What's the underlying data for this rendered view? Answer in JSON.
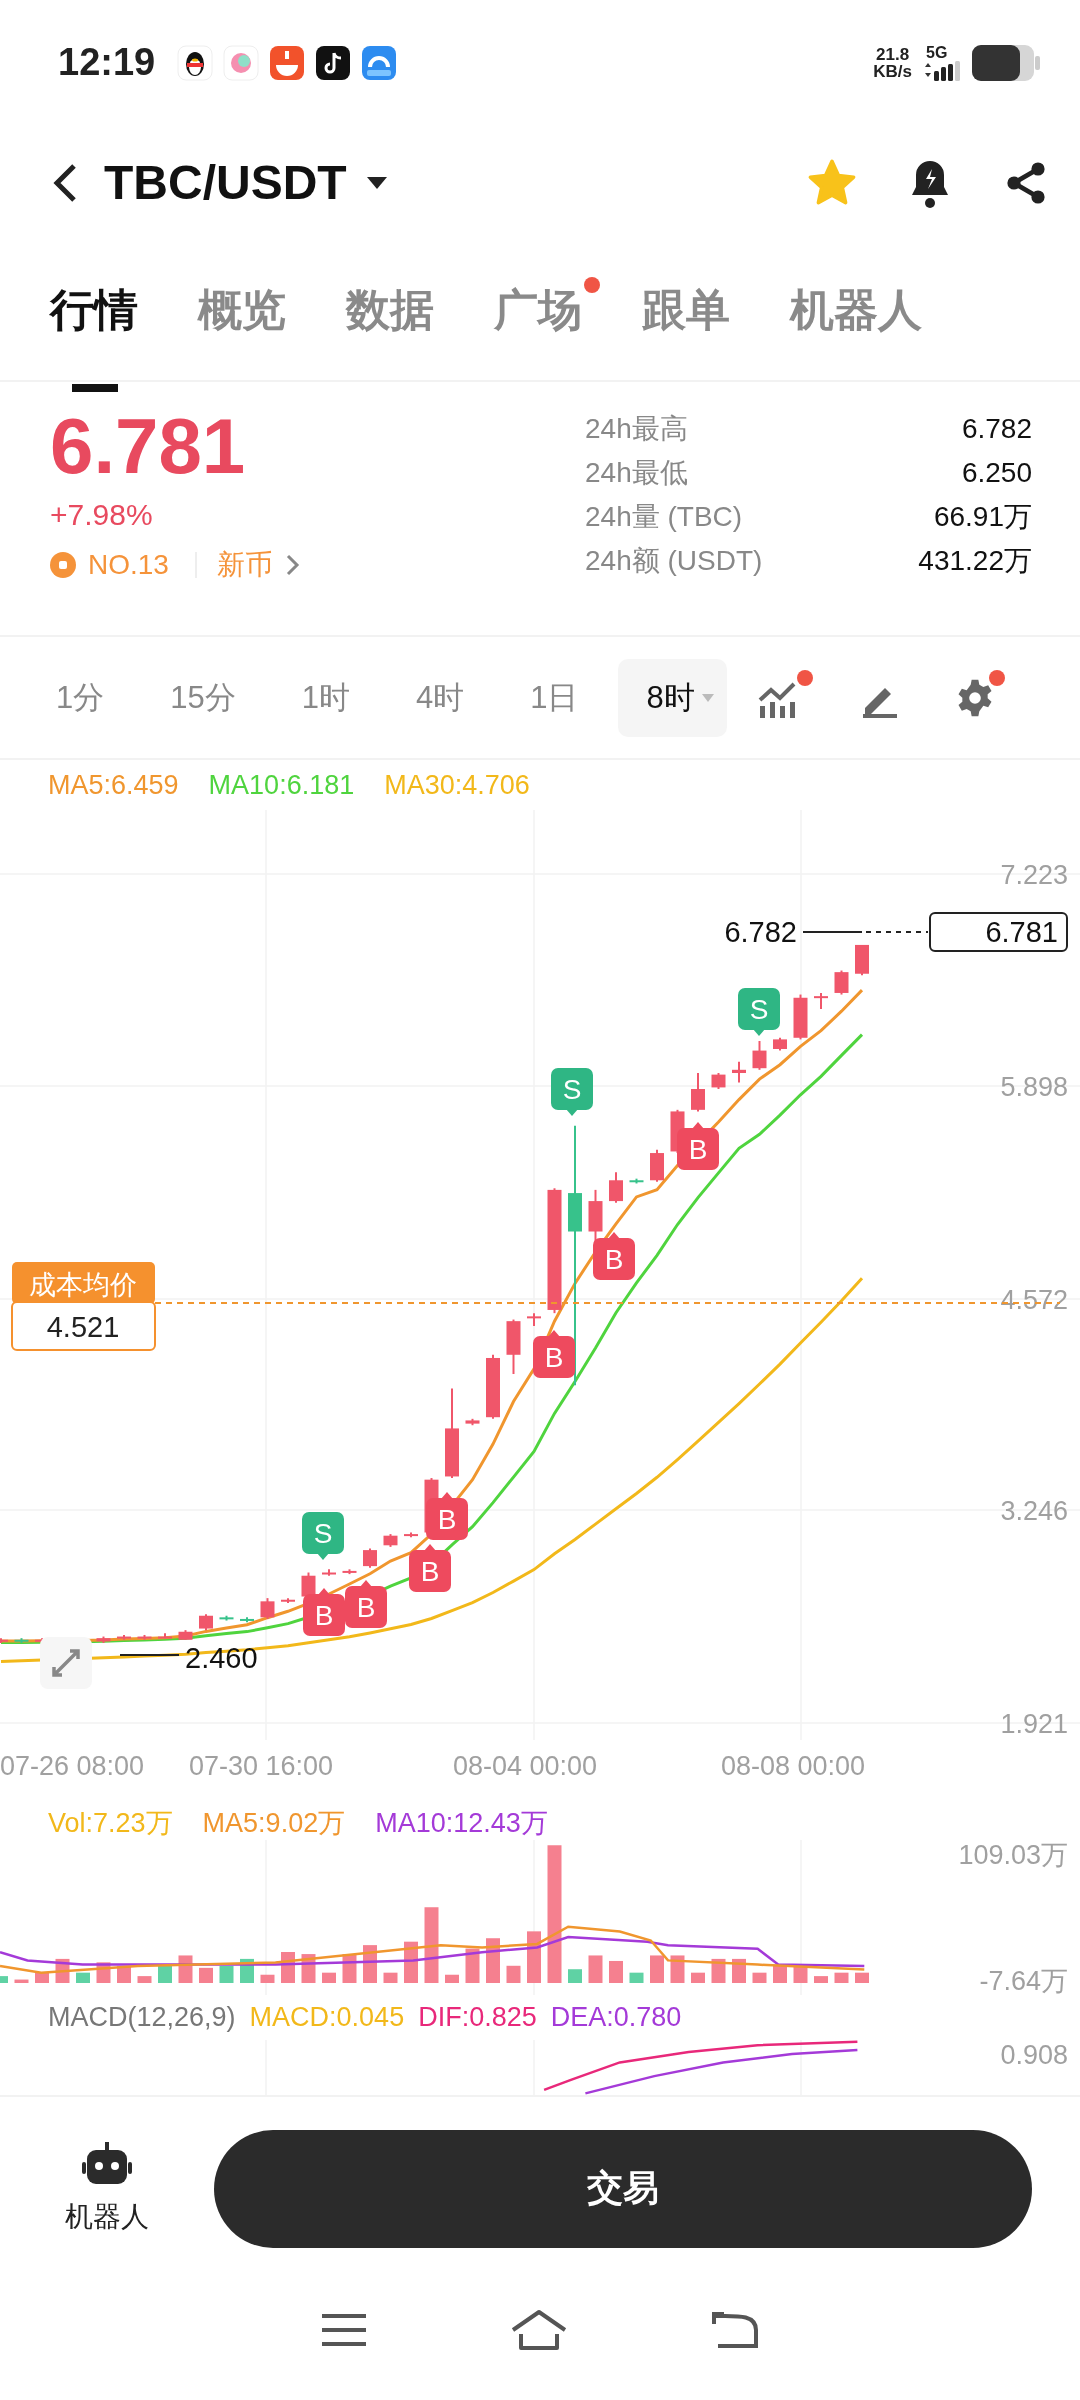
{
  "status_bar": {
    "time": "12:19",
    "net_speed": "21.8",
    "net_speed_unit": "KB/s",
    "network": "5G"
  },
  "header": {
    "pair": "TBC/USDT",
    "favorite": true
  },
  "tabs": [
    {
      "label": "行情",
      "selected": true,
      "badge": false
    },
    {
      "label": "概览",
      "selected": false,
      "badge": false
    },
    {
      "label": "数据",
      "selected": false,
      "badge": false
    },
    {
      "label": "广场",
      "selected": false,
      "badge": true
    },
    {
      "label": "跟单",
      "selected": false,
      "badge": false
    },
    {
      "label": "机器人",
      "selected": false,
      "badge": false
    }
  ],
  "ticker": {
    "price": "6.781",
    "change": "+7.98%",
    "rank": "NO.13",
    "tag": "新币",
    "stats": [
      {
        "label": "24h最高",
        "value": "6.782"
      },
      {
        "label": "24h最低",
        "value": "6.250"
      },
      {
        "label": "24h量 (TBC)",
        "value": "66.91万"
      },
      {
        "label": "24h额 (USDT)",
        "value": "431.22万"
      }
    ]
  },
  "intervals": [
    {
      "label": "1分",
      "selected": false
    },
    {
      "label": "15分",
      "selected": false
    },
    {
      "label": "1时",
      "selected": false
    },
    {
      "label": "4时",
      "selected": false
    },
    {
      "label": "1日",
      "selected": false
    },
    {
      "label": "8时",
      "selected": true
    }
  ],
  "tools": [
    {
      "kind": "indicator",
      "badge": true
    },
    {
      "kind": "draw",
      "badge": false
    },
    {
      "kind": "settings",
      "badge": true
    }
  ],
  "main_chart": {
    "legend": [
      {
        "label": "MA5:6.459",
        "color": "#f0962e"
      },
      {
        "label": "MA10:6.181",
        "color": "#4fd43e"
      },
      {
        "label": "MA30:4.706",
        "color": "#f2b81a"
      }
    ],
    "y_ticks": [
      "7.223",
      "5.898",
      "4.572",
      "3.246",
      "1.921"
    ],
    "x_labels": [
      "07-26 08:00",
      "07-30 16:00",
      "08-04 00:00",
      "08-08 00:00"
    ],
    "high_label": "6.782",
    "last_price": "6.781",
    "low_label": "2.460",
    "cost": {
      "label": "成本均价",
      "value": "4.521"
    },
    "markers": [
      {
        "kind": "sell",
        "label": "S"
      },
      {
        "kind": "buy",
        "label": "B"
      },
      {
        "kind": "buy",
        "label": "B"
      },
      {
        "kind": "buy",
        "label": "B"
      },
      {
        "kind": "buy",
        "label": "B"
      },
      {
        "kind": "buy",
        "label": "B"
      },
      {
        "kind": "sell",
        "label": "S"
      },
      {
        "kind": "buy",
        "label": "B"
      },
      {
        "kind": "buy",
        "label": "B"
      },
      {
        "kind": "sell",
        "label": "S"
      }
    ]
  },
  "volume": {
    "legend": [
      {
        "label": "Vol:7.23万",
        "color": "#f2b81a"
      },
      {
        "label": "MA5:9.02万",
        "color": "#f0962e"
      },
      {
        "label": "MA10:12.43万",
        "color": "#a43ad8"
      }
    ],
    "y_ticks": [
      "109.03万",
      "-7.64万"
    ]
  },
  "macd": {
    "legend": [
      {
        "label": "MACD(12,26,9)",
        "color": "#777777"
      },
      {
        "label": "MACD:0.045",
        "color": "#f2b81a"
      },
      {
        "label": "DIF:0.825",
        "color": "#e8287a"
      },
      {
        "label": "DEA:0.780",
        "color": "#a43ad8"
      }
    ],
    "y_ticks": [
      "0.908"
    ]
  },
  "bottom": {
    "robot_label": "机器人",
    "trade_button": "交易"
  }
}
